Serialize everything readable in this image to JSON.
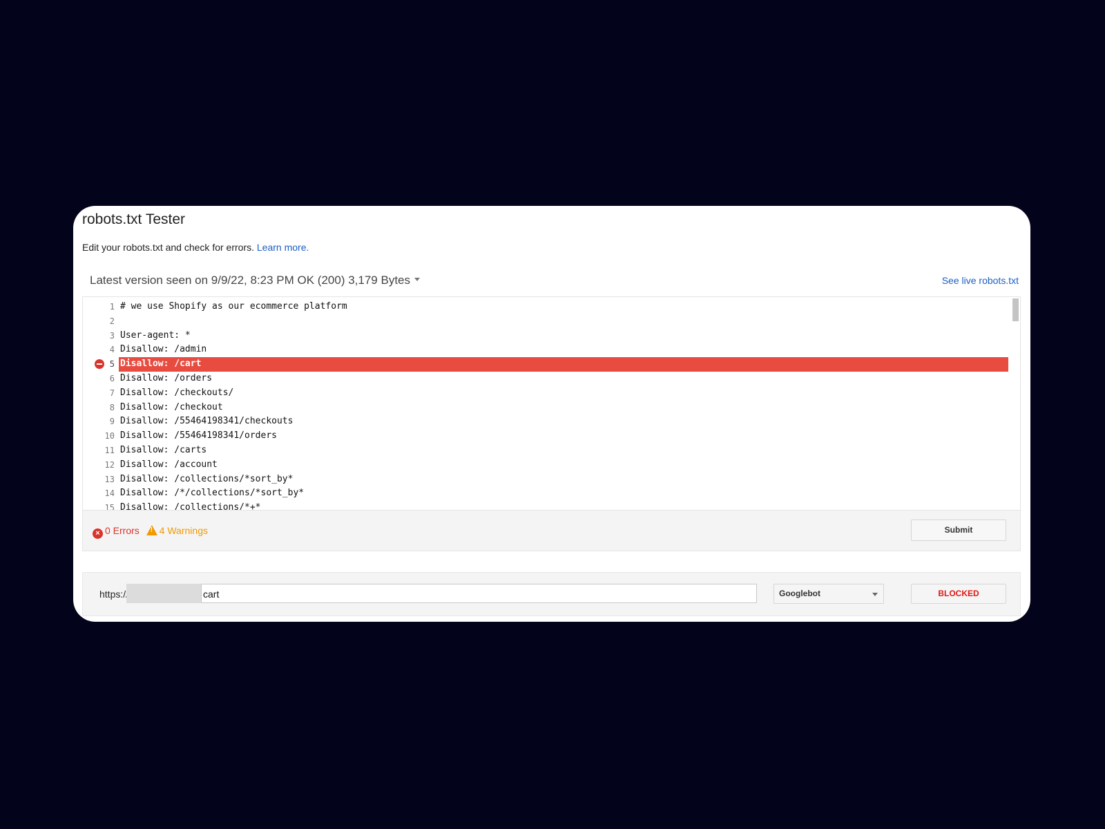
{
  "header": {
    "title": "robots.txt Tester",
    "description": "Edit your robots.txt and check for errors.",
    "learn_more": "Learn more."
  },
  "version_bar": {
    "label": "Latest version seen on 9/9/22, 8:23 PM OK (200) 3,179 Bytes",
    "live_link": "See live robots.txt"
  },
  "editor": {
    "lines": [
      {
        "n": "1",
        "text": "# we use Shopify as our ecommerce platform"
      },
      {
        "n": "2",
        "text": ""
      },
      {
        "n": "3",
        "text": "User-agent: *"
      },
      {
        "n": "4",
        "text": "Disallow: /admin"
      },
      {
        "n": "5",
        "text": "Disallow: /cart",
        "error": true
      },
      {
        "n": "6",
        "text": "Disallow: /orders"
      },
      {
        "n": "7",
        "text": "Disallow: /checkouts/"
      },
      {
        "n": "8",
        "text": "Disallow: /checkout"
      },
      {
        "n": "9",
        "text": "Disallow: /55464198341/checkouts"
      },
      {
        "n": "10",
        "text": "Disallow: /55464198341/orders"
      },
      {
        "n": "11",
        "text": "Disallow: /carts"
      },
      {
        "n": "12",
        "text": "Disallow: /account"
      },
      {
        "n": "13",
        "text": "Disallow: /collections/*sort_by*"
      },
      {
        "n": "14",
        "text": "Disallow: /*/collections/*sort_by*"
      },
      {
        "n": "15",
        "text": "Disallow: /collections/*+*"
      }
    ]
  },
  "status": {
    "errors_label": "0 Errors",
    "warnings_label": "4 Warnings",
    "submit_label": "Submit",
    "error_color": "#d9342b",
    "warning_color": "#f29900"
  },
  "tester": {
    "url_prefix": "https://",
    "url_value": "cart",
    "user_agent": "Googlebot",
    "result_label": "BLOCKED",
    "result_color": "#e01818"
  },
  "icons": {
    "error_marker": "blocked-line-icon",
    "errors": "error-circle-icon",
    "warnings": "warning-triangle-icon"
  }
}
